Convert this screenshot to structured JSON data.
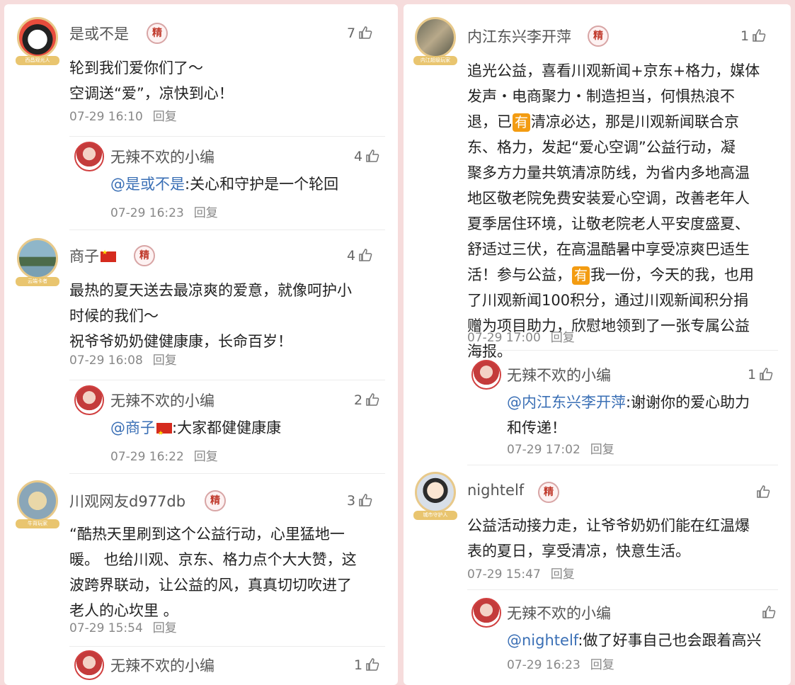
{
  "left": {
    "comments": [
      {
        "user": "是或不是",
        "badge": "精",
        "avatar_tag": "西昌观光人",
        "likes": "7",
        "lines": [
          "轮到我们爱你们了～",
          "空调送“爱”，凉快到心！"
        ],
        "time": "07-29  16:10",
        "reply_label": "回复",
        "reply": {
          "user": "无辣不欢的小编",
          "likes": "4",
          "mention": "@是或不是",
          "text": ":关心和守护是一个轮回",
          "time": "07-29  16:23",
          "reply_label": "回复"
        }
      },
      {
        "user": "商子",
        "badge": "精",
        "avatar_tag": "云端卡者",
        "likes": "4",
        "lines": [
          "最热的夏天送去最凉爽的爱意，就像呵护小",
          "时候的我们～",
          "祝爷爷奶奶健健康康，长命百岁！"
        ],
        "time": "07-29  16:08",
        "reply_label": "回复",
        "reply": {
          "user": "无辣不欢的小编",
          "likes": "2",
          "mention": "@商子",
          "text": ":大家都健健康康",
          "time": "07-29  16:22",
          "reply_label": "回复"
        }
      },
      {
        "user": "川观网友d977db",
        "badge": "精",
        "avatar_tag": "牛背玩家",
        "likes": "3",
        "lines": [
          "“酷热天里刷到这个公益行动，心里猛地一",
          "暖。 也给川观、京东、格力点个大大赞，这",
          "波跨界联动，让公益的风，真真切切吹进了",
          "老人的心坎里  。"
        ],
        "time": "07-29  15:54",
        "reply_label": "回复",
        "reply": {
          "user": "无辣不欢的小编",
          "likes": "1"
        }
      }
    ]
  },
  "right": {
    "comments": [
      {
        "user": "内江东兴李开萍",
        "badge": "精",
        "avatar_tag": "内江超级玩家",
        "likes": "1",
        "lines": [
          "追光公益，喜看川观新闻+京东+格力，媒体",
          "发声・电商聚力・制造担当，何惧热浪不",
          "退，已|有|清凉必达，那是川观新闻联合京",
          "东、格力，发起“爱心空调”公益行动，凝",
          "聚多方力量共筑清凉防线，为省内多地高温",
          "地区敬老院免费安装爱心空调，改善老年人",
          "夏季居住环境，让敬老院老人平安度盛夏、",
          "舒适过三伏，在高温酷暑中享受凉爽巴适生",
          "活！参与公益，|有|我一份，今天的我，也用",
          "了川观新闻100积分，通过川观新闻积分捐",
          "赠为项目助力，欣慰地领到了一张专属公益",
          "海报。"
        ],
        "time": "07-29  17:00",
        "reply_label": "回复",
        "reply": {
          "user": "无辣不欢的小编",
          "likes": "1",
          "mention": "@内江东兴李开萍",
          "text": ":谢谢你的爱心助力",
          "text2": "和传递！",
          "time": "07-29  17:02",
          "reply_label": "回复"
        }
      },
      {
        "user": "nightelf",
        "badge": "精",
        "avatar_tag": "城市守护人",
        "likes": "",
        "lines": [
          "公益活动接力走，让爷爷奶奶们能在红温爆",
          "表的夏日，享受清凉，快意生活。"
        ],
        "time": "07-29  15:47",
        "reply_label": "回复",
        "reply": {
          "user": "无辣不欢的小编",
          "likes": "",
          "mention": "@nightelf",
          "text": ":做了好事自己也会跟着高兴",
          "time": "07-29  16:23",
          "reply_label": "回复"
        }
      }
    ]
  },
  "colors": {
    "mention": "#3a6fb5",
    "badge": "#c0392b",
    "meta": "#888888",
    "bg": "#f6dcdc"
  }
}
